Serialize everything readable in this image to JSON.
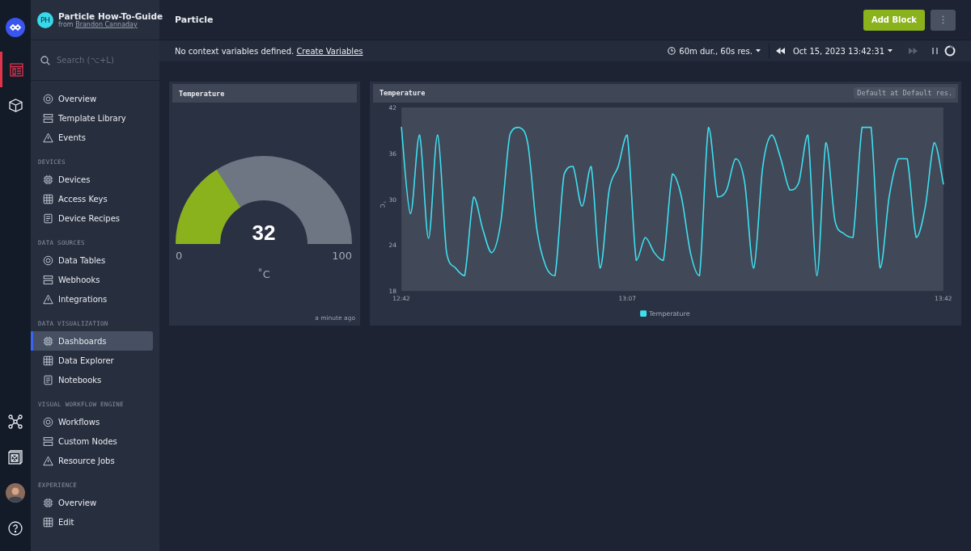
{
  "workspace": {
    "initials": "PH",
    "name": "Particle How-To-Guide",
    "from_label": "from",
    "owner": "Brandon Cannaday"
  },
  "search": {
    "placeholder": "Search (⌥+L)"
  },
  "nav": [
    {
      "items": [
        {
          "label": "Overview",
          "selected": false
        },
        {
          "label": "Template Library",
          "selected": false
        },
        {
          "label": "Events",
          "selected": false
        }
      ]
    },
    {
      "heading": "DEVICES",
      "items": [
        {
          "label": "Devices",
          "selected": false
        },
        {
          "label": "Access Keys",
          "selected": false
        },
        {
          "label": "Device Recipes",
          "selected": false
        }
      ]
    },
    {
      "heading": "DATA SOURCES",
      "items": [
        {
          "label": "Data Tables",
          "selected": false
        },
        {
          "label": "Webhooks",
          "selected": false
        },
        {
          "label": "Integrations",
          "selected": false
        }
      ]
    },
    {
      "heading": "DATA VISUALIZATION",
      "items": [
        {
          "label": "Dashboards",
          "selected": true
        },
        {
          "label": "Data Explorer",
          "selected": false
        },
        {
          "label": "Notebooks",
          "selected": false
        }
      ]
    },
    {
      "heading": "VISUAL WORKFLOW ENGINE",
      "items": [
        {
          "label": "Workflows",
          "selected": false
        },
        {
          "label": "Custom Nodes",
          "selected": false
        },
        {
          "label": "Resource Jobs",
          "selected": false
        }
      ]
    },
    {
      "heading": "EXPERIENCE",
      "items": [
        {
          "label": "Overview",
          "selected": false
        },
        {
          "label": "Edit",
          "selected": false
        }
      ]
    }
  ],
  "header": {
    "title": "Particle",
    "add_button": "Add Block"
  },
  "context_bar": {
    "message": "No context variables defined.",
    "link": "Create Variables",
    "duration": "60m dur., 60s res.",
    "timestamp": "Oct 15, 2023 13:42:31"
  },
  "gauge": {
    "title": "Temperature",
    "value": "32",
    "level": 0.32,
    "min": "0",
    "max": "100",
    "unit": "˚C",
    "updated": "a minute ago"
  },
  "line_block": {
    "title": "Temperature",
    "resolution": "Default at Default res.",
    "chart_data": {
      "type": "line",
      "ylabel": "˚C",
      "categories": [
        "12:42",
        null,
        null,
        null,
        null,
        null,
        null,
        null,
        null,
        null,
        null,
        null,
        null,
        null,
        null,
        null,
        null,
        null,
        null,
        null,
        null,
        null,
        null,
        null,
        null,
        "13:07",
        null,
        null,
        null,
        null,
        null,
        null,
        null,
        null,
        null,
        null,
        null,
        null,
        null,
        null,
        null,
        null,
        null,
        null,
        null,
        null,
        null,
        null,
        null,
        null,
        null,
        null,
        null,
        null,
        null,
        null,
        null,
        null,
        null,
        null,
        "13:42"
      ],
      "ylim": [
        18,
        42
      ],
      "yticks": [
        18,
        24,
        30,
        36,
        42
      ],
      "series": [
        {
          "name": "Temperature",
          "color": "#3ee0f0",
          "values": [
            39.4,
            28.1,
            38.4,
            24.9,
            38.4,
            23,
            21,
            20,
            30.3,
            26.1,
            23,
            27,
            38.4,
            39.4,
            37.2,
            26,
            21.2,
            20,
            33.2,
            34.3,
            29.1,
            34.3,
            21,
            31.2,
            34.3,
            38.4,
            22,
            25,
            23,
            22,
            33.3,
            30.3,
            23,
            20,
            39.4,
            30.3,
            31.2,
            35.3,
            32.2,
            21,
            34.2,
            38.4,
            35.3,
            31.2,
            32.2,
            38.4,
            20,
            37.4,
            27.2,
            25.5,
            25,
            39.4,
            39.4,
            21,
            30.3,
            35.3,
            35.3,
            25,
            29,
            37.4,
            32
          ]
        }
      ]
    }
  }
}
